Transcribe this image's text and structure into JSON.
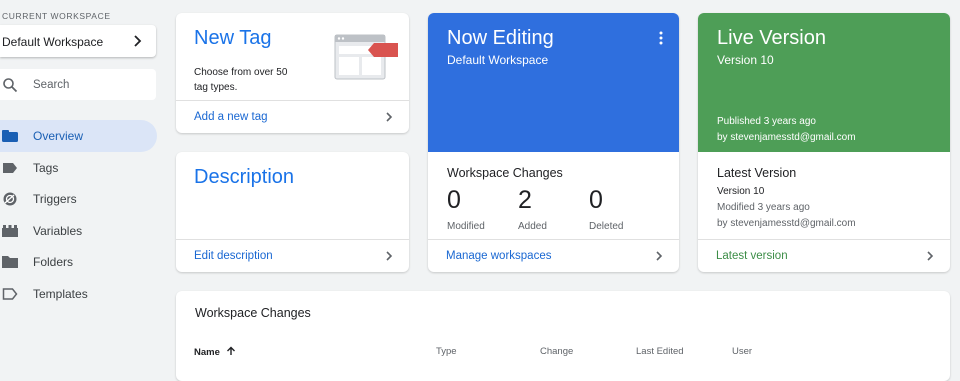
{
  "sidebar": {
    "workspace_label": "CURRENT WORKSPACE",
    "workspace_name": "Default Workspace",
    "search_placeholder": "Search",
    "nav": [
      {
        "label": "Overview",
        "icon": "overview-icon",
        "active": true
      },
      {
        "label": "Tags",
        "icon": "tag-icon"
      },
      {
        "label": "Triggers",
        "icon": "trigger-icon"
      },
      {
        "label": "Variables",
        "icon": "variable-icon"
      },
      {
        "label": "Folders",
        "icon": "folder-icon"
      },
      {
        "label": "Templates",
        "icon": "template-icon"
      }
    ]
  },
  "new_tag": {
    "title": "New Tag",
    "description": "Choose from over 50 tag types.",
    "link": "Add a new tag"
  },
  "description_card": {
    "title": "Description",
    "link": "Edit description"
  },
  "now_editing": {
    "title": "Now Editing",
    "workspace": "Default Workspace",
    "color": "#2f6fde",
    "changes_title": "Workspace Changes",
    "stats": [
      {
        "value": "0",
        "label": "Modified"
      },
      {
        "value": "2",
        "label": "Added"
      },
      {
        "value": "0",
        "label": "Deleted"
      }
    ],
    "link": "Manage workspaces"
  },
  "live_version": {
    "title": "Live Version",
    "version": "Version 10",
    "color": "#4e9e57",
    "published": "Published 3 years ago",
    "published_by": "by stevenjamesstd@gmail.com",
    "latest_title": "Latest Version",
    "latest_version": "Version 10",
    "latest_modified": "Modified 3 years ago",
    "latest_by": "by stevenjamesstd@gmail.com",
    "link": "Latest version"
  },
  "changes_table": {
    "title": "Workspace Changes",
    "columns": [
      "Name",
      "Type",
      "Change",
      "Last Edited",
      "User"
    ]
  }
}
